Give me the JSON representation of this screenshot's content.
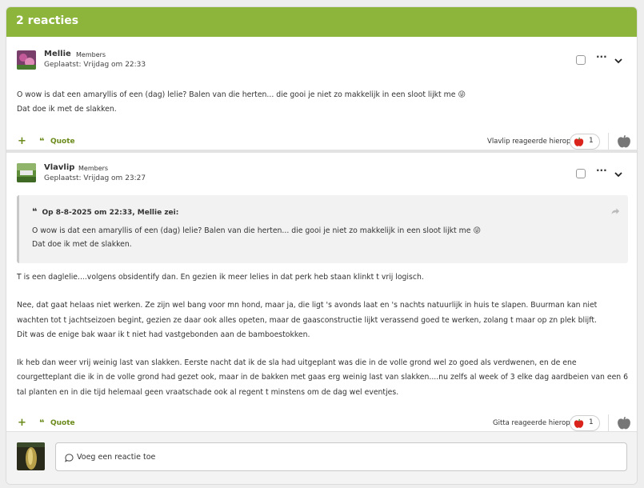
{
  "header": {
    "title": "2 reacties"
  },
  "posts": [
    {
      "author": "Mellie",
      "group": "Members",
      "posted": "Geplaatst: Vrijdag om 22:33",
      "paragraphs": [
        "O wow is dat een amaryllis of een (dag) lelie? Balen van die herten... die gooi je niet zo makkelijk in een sloot lijkt me 😜",
        "Dat doe ik met de slakken."
      ],
      "quote_label": "Quote",
      "reaction_text": "Vlavlip reageerde hierop",
      "reaction_count": "1"
    },
    {
      "author": "Vlavlip",
      "group": "Members",
      "posted": "Geplaatst: Vrijdag om 23:27",
      "quote": {
        "header": "Op 8-8-2025 om 22:33, Mellie zei:",
        "line1": "O wow is dat een amaryllis of een (dag) lelie? Balen van die herten... die gooi je niet zo makkelijk in een sloot lijkt me 😜",
        "line2": "Dat doe ik met de slakken."
      },
      "paragraphs": [
        "T is een daglelie....volgens obsidentify dan. En gezien ik meer lelies in dat perk heb staan klinkt t vrij logisch.",
        "Nee, dat gaat helaas niet werken. Ze zijn wel bang voor mn hond, maar ja, die ligt 's avonds laat en 's nachts natuurlijk in huis te slapen. Buurman kan niet wachten tot t jachtseizoen begint, gezien ze daar ook alles opeten, maar de gaasconstructie lijkt verassend goed te werken, zolang t maar op zn plek blijft.",
        "Dit was de enige bak waar ik t niet had vastgebonden aan de bamboestokken.",
        "Ik heb dan weer vrij weinig last van slakken. Eerste nacht dat ik de sla had uitgeplant was die in de volle grond wel zo goed als verdwenen, en de ene courgetteplant die ik in de volle grond had gezet ook, maar in de bakken met gaas erg weinig last van slakken....nu zelfs al week of 3 elke dag aardbeien van een 6 tal planten en in die tijd helemaal geen vraatschade ook al regent t minstens om de dag wel eventjes."
      ],
      "quote_label": "Quote",
      "reaction_text": "Gitta reageerde hierop",
      "reaction_count": "1"
    }
  ],
  "comment": {
    "placeholder": "Voeg een reactie toe"
  },
  "colors": {
    "header_bg": "#8db53c",
    "accent": "#6a8a1a",
    "reaction_red": "#d9231b"
  },
  "icons": [
    "plus-icon",
    "quote-icon",
    "chevron-down-icon",
    "more-icon",
    "apple-react-icon",
    "share-icon",
    "comment-bubble-icon"
  ]
}
